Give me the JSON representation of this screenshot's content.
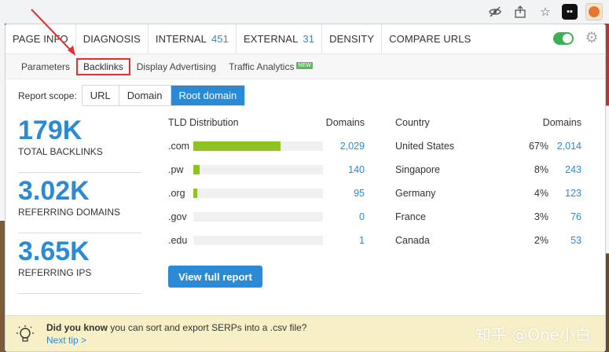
{
  "nav": {
    "items": [
      {
        "label": "PAGE INFO",
        "count": ""
      },
      {
        "label": "DIAGNOSIS",
        "count": ""
      },
      {
        "label": "INTERNAL",
        "count": "451"
      },
      {
        "label": "EXTERNAL",
        "count": "31"
      },
      {
        "label": "DENSITY",
        "count": ""
      },
      {
        "label": "COMPARE URLS",
        "count": ""
      }
    ]
  },
  "subnav": {
    "items": [
      "Parameters",
      "Backlinks",
      "Display Advertising",
      "Traffic Analytics"
    ],
    "badge": "NEW"
  },
  "scope": {
    "label": "Report scope:",
    "options": [
      "URL",
      "Domain",
      "Root domain"
    ]
  },
  "metrics": [
    {
      "value": "179K",
      "label": "TOTAL BACKLINKS"
    },
    {
      "value": "3.02K",
      "label": "REFERRING DOMAINS"
    },
    {
      "value": "3.65K",
      "label": "REFERRING IPS"
    }
  ],
  "tld": {
    "title": "TLD Distribution",
    "col": "Domains",
    "rows": [
      {
        "name": ".com",
        "value": "2,029",
        "fraction": 0.67
      },
      {
        "name": ".pw",
        "value": "140",
        "fraction": 0.05
      },
      {
        "name": ".org",
        "value": "95",
        "fraction": 0.03
      },
      {
        "name": ".gov",
        "value": "0",
        "fraction": 0
      },
      {
        "name": ".edu",
        "value": "1",
        "fraction": 0
      }
    ]
  },
  "view_full_report": "View full report",
  "country": {
    "title": "Country",
    "col": "Domains",
    "rows": [
      {
        "name": "United States",
        "pct": "67%",
        "value": "2,014"
      },
      {
        "name": "Singapore",
        "pct": "8%",
        "value": "243"
      },
      {
        "name": "Germany",
        "pct": "4%",
        "value": "123"
      },
      {
        "name": "France",
        "pct": "3%",
        "value": "76"
      },
      {
        "name": "Canada",
        "pct": "2%",
        "value": "53"
      }
    ]
  },
  "tip": {
    "bold": "Did you know",
    "text": " you can sort and export SERPs into a .csv file?",
    "link": "Next tip >"
  },
  "watermark": "知乎 @One小白",
  "colors": {
    "accent": "#2b8ad6",
    "bar": "#8fc31f",
    "toggle": "#3db051",
    "highlight": "#e03131"
  }
}
